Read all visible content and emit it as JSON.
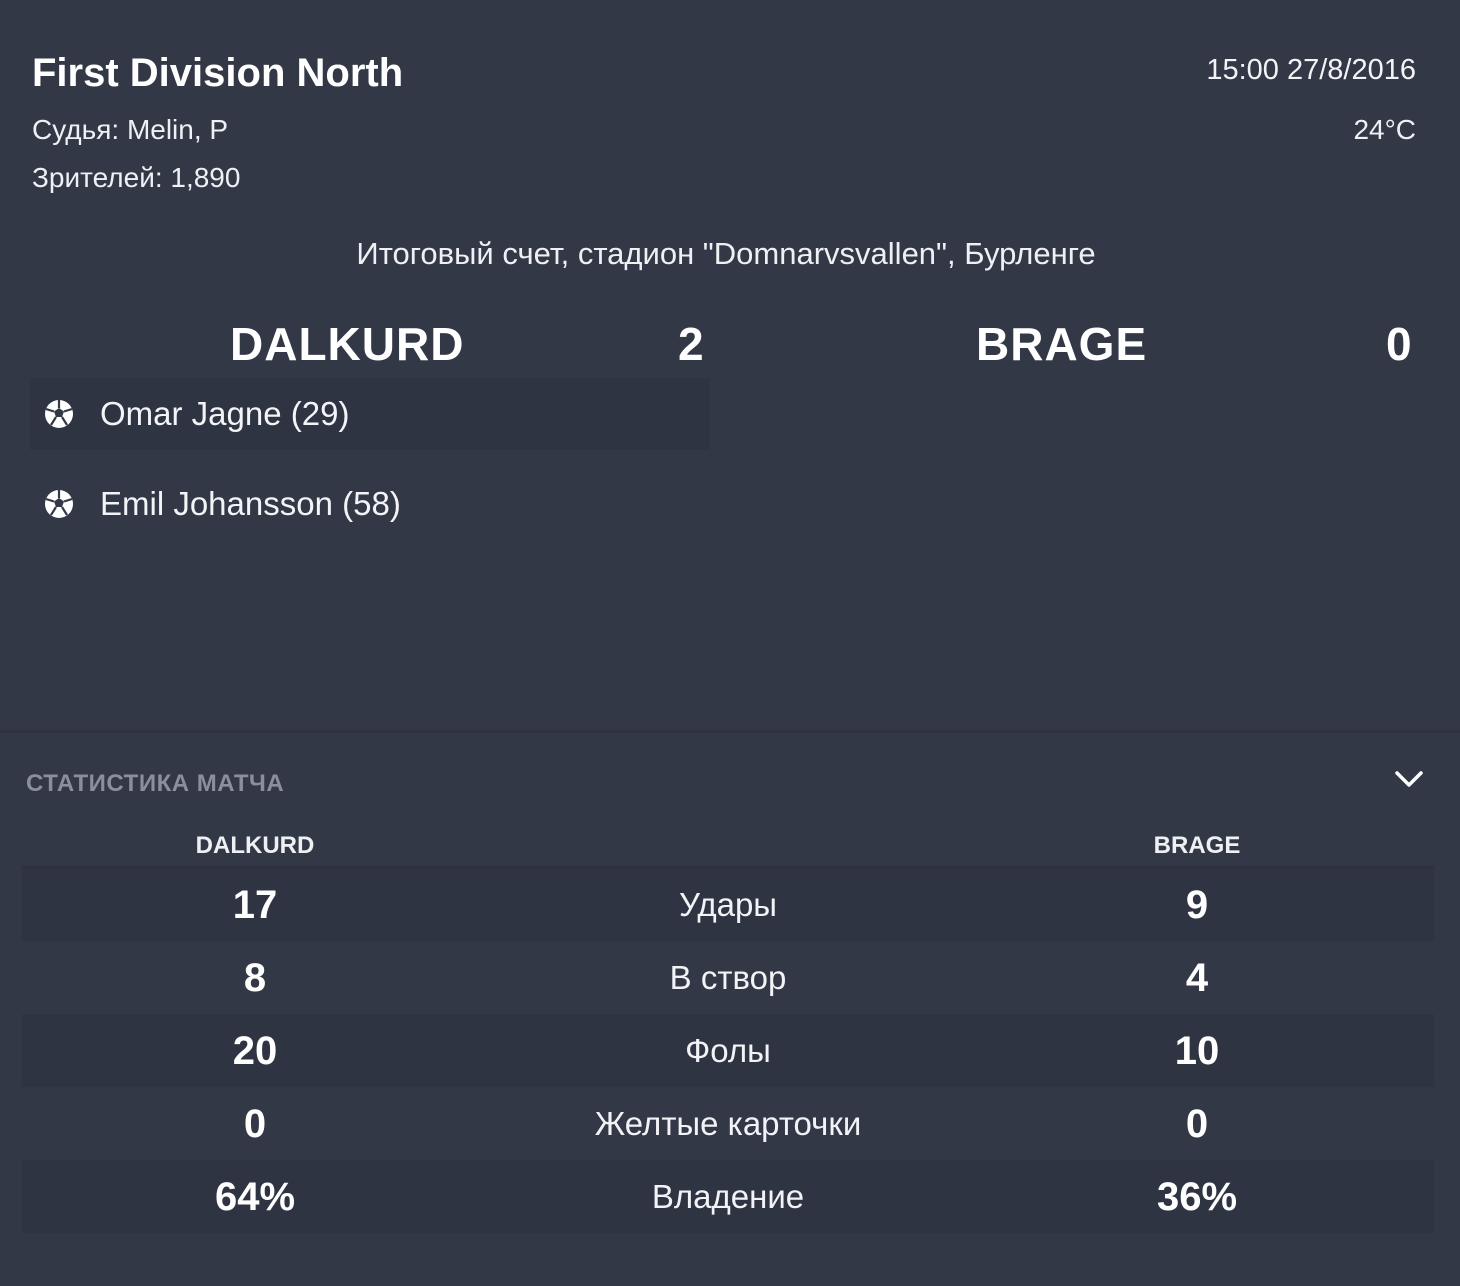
{
  "match": {
    "competition": "First Division North",
    "kickoff": "15:00 27/8/2016",
    "referee": "Судья: Melin, P",
    "temperature": "24°C",
    "attendance": "Зрителей: 1,890",
    "venue_line": "Итоговый счет, стадион \"Domnarvsvallen\", Бурленге"
  },
  "score": {
    "home_team": "DALKURD",
    "home_goals": "2",
    "away_team": "BRAGE",
    "away_goals": "0"
  },
  "scorers": [
    {
      "text": "Omar Jagne (29)",
      "icon": "soccer-ball-icon"
    },
    {
      "text": "Emil Johansson (58)",
      "icon": "soccer-ball-icon"
    }
  ],
  "stats": {
    "title": "СТАТИСТИКА МАТЧА",
    "home_header": "DALKURD",
    "away_header": "BRAGE",
    "rows": [
      {
        "label": "Удары",
        "home": "17",
        "away": "9"
      },
      {
        "label": "В створ",
        "home": "8",
        "away": "4"
      },
      {
        "label": "Фолы",
        "home": "20",
        "away": "10"
      },
      {
        "label": "Желтые карточки",
        "home": "0",
        "away": "0"
      },
      {
        "label": "Владение",
        "home": "64%",
        "away": "36%"
      }
    ]
  },
  "colors": {
    "background": "#333847",
    "shaded_row": "#2f3442",
    "muted_text": "#8a8f9b",
    "text": "#ffffff"
  }
}
